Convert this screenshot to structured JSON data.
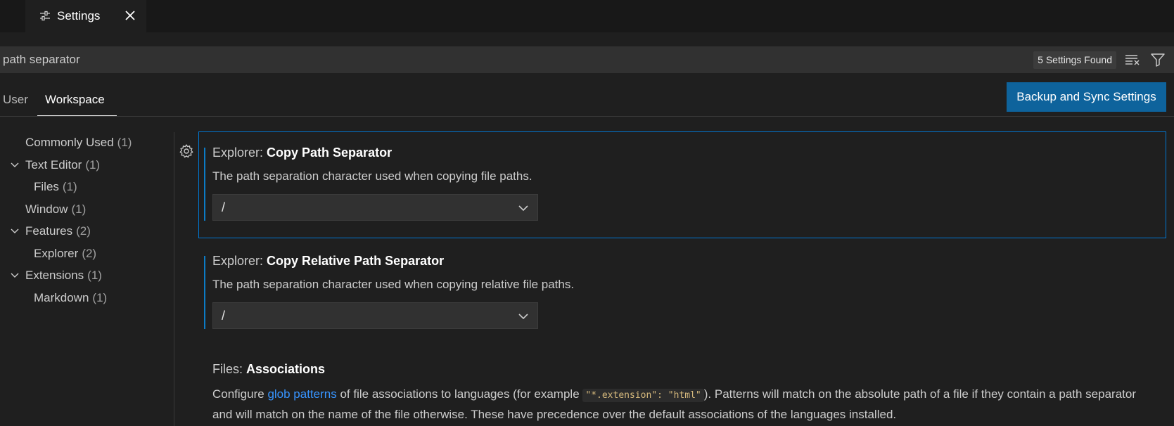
{
  "tab": {
    "label": "Settings",
    "icon": "settings-sliders-icon"
  },
  "search": {
    "value": "path separator",
    "results_label": "5 Settings Found"
  },
  "scope": {
    "user_label": "User",
    "workspace_label": "Workspace",
    "active": "Workspace"
  },
  "sync_button": {
    "label": "Backup and Sync Settings"
  },
  "toc": [
    {
      "label": "Commonly Used",
      "count": "(1)"
    },
    {
      "label": "Text Editor",
      "count": "(1)"
    },
    {
      "label": "Files",
      "count": "(1)"
    },
    {
      "label": "Window",
      "count": "(1)"
    },
    {
      "label": "Features",
      "count": "(2)"
    },
    {
      "label": "Explorer",
      "count": "(2)"
    },
    {
      "label": "Extensions",
      "count": "(1)"
    },
    {
      "label": "Markdown",
      "count": "(1)"
    }
  ],
  "settings": [
    {
      "category": "Explorer: ",
      "name": "Copy Path Separator",
      "description": "The path separation character used when copying file paths.",
      "value": "/"
    },
    {
      "category": "Explorer: ",
      "name": "Copy Relative Path Separator",
      "description": "The path separation character used when copying relative file paths.",
      "value": "/"
    },
    {
      "category": "Files: ",
      "name": "Associations",
      "desc_part1": "Configure ",
      "desc_link": "glob patterns",
      "desc_part2": " of file associations to languages (for example ",
      "desc_code": "\"*.extension\": \"html\"",
      "desc_part3": "). Patterns will match on the absolute path of a file if they contain a path separator and will match on the name of the file otherwise. These have precedence over the default associations of the languages installed."
    }
  ],
  "colors": {
    "accent": "#0e639c",
    "focus_border": "#0078d4",
    "link": "#3794ff",
    "modified_bar": "#0c7bc5"
  }
}
